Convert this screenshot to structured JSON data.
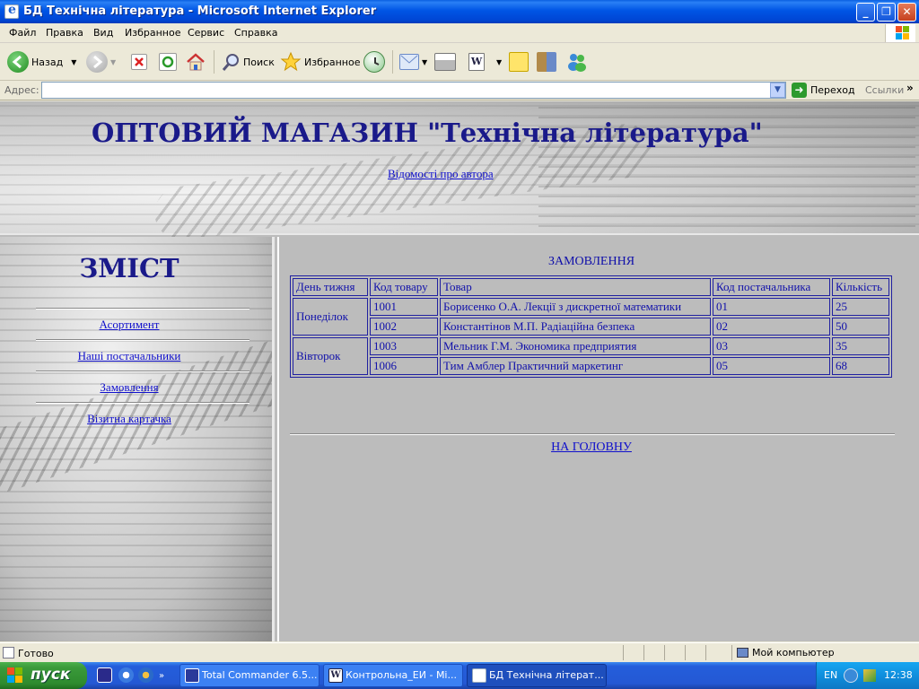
{
  "window": {
    "title": "БД Технічна література - Microsoft Internet Explorer",
    "buttons": [
      "minimize",
      "maximize",
      "close"
    ]
  },
  "menu": [
    "Файл",
    "Правка",
    "Вид",
    "Избранное",
    "Сервис",
    "Справка"
  ],
  "toolbar": {
    "back_label": "Назад",
    "search_label": "Поиск",
    "favorites_label": "Избранное"
  },
  "address": {
    "label": "Адрес:",
    "value": "",
    "go_label": "Переход",
    "links_label": "Ссылки"
  },
  "header": {
    "title": "ОПТОВИЙ МАГАЗИН \"Технічна література\"",
    "author_link": "Відомості про автора"
  },
  "toc": {
    "title": "ЗМІСТ",
    "links": [
      "Асортимент",
      "Наші постачальники",
      "Замовлення",
      "Візитна картачка"
    ]
  },
  "orders": {
    "caption": "ЗАМОВЛЕННЯ",
    "headers": [
      "День тижня",
      "Код товару",
      "Товар",
      "Код постачальника",
      "Кількість"
    ],
    "groups": [
      {
        "day": "Понеділок",
        "rows": [
          {
            "code": "1001",
            "item": "Борисенко О.А. Лекції з дискретної математики",
            "supplier": "01",
            "qty": "25"
          },
          {
            "code": "1002",
            "item": "Константінов М.П. Радіаційна безпека",
            "supplier": "02",
            "qty": "50"
          }
        ]
      },
      {
        "day": "Вівторок",
        "rows": [
          {
            "code": "1003",
            "item": "Мельник Г.М. Экономика предприятия",
            "supplier": "03",
            "qty": "35"
          },
          {
            "code": "1006",
            "item": "Тим Амблер Практичний маркетинг",
            "supplier": "05",
            "qty": "68"
          }
        ]
      }
    ],
    "home_link": "НА ГОЛОВНУ"
  },
  "status": {
    "text": "Готово",
    "zone": "Мой компьютер"
  },
  "taskbar": {
    "start_label": "пуск",
    "tasks": [
      "Total Commander 6.5...",
      "Контрольна_ЕИ - Mi...",
      "БД Технічна літерат..."
    ],
    "language": "EN",
    "clock": "12:38"
  },
  "colors": {
    "title_blue": "#1a1a8a",
    "link_blue": "#1010cc",
    "table_border": "#2020a0",
    "page_gray": "#bcbcbc",
    "xp_titlebar": "#0055e5"
  }
}
